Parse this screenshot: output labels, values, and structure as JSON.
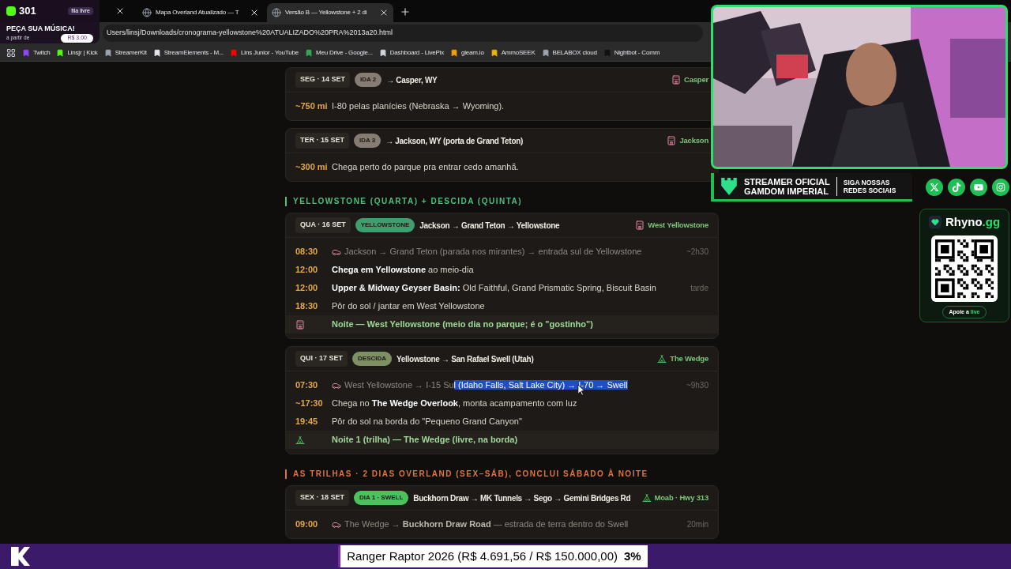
{
  "overlay_widget": {
    "count": "301",
    "chip": "fila livre",
    "title": "PEÇA SUA MÚSICA!",
    "price_label": "a partir de",
    "price": "R$ 3.00"
  },
  "browser": {
    "tabs": [
      {
        "title": "Mapa Overland Atualizado — T",
        "selected": false
      },
      {
        "title": "Versão B — Yellowstone + 2 di",
        "selected": true
      }
    ],
    "address": "Users/linsj/Downloads/cronograma-yellowstone%20ATUALIZADO%20PRA%2013a20.html",
    "bookmarks": [
      {
        "label": "Twitch",
        "color": "#9146ff"
      },
      {
        "label": "Linsjr | Kick",
        "color": "#53fc18"
      },
      {
        "label": "StreamerKit",
        "color": "#9ca3af"
      },
      {
        "label": "StreamElements - M...",
        "color": "#e5e7eb"
      },
      {
        "label": "Lins Junior - YouTube",
        "color": "#ff0000"
      },
      {
        "label": "Meu Drive - Google...",
        "color": "#34a853"
      },
      {
        "label": "Dashboard - LivePix",
        "color": "#d1d5db"
      },
      {
        "label": "gleam.io",
        "color": "#f59e0b"
      },
      {
        "label": "AmmoSEEK",
        "color": "#eab308"
      },
      {
        "label": "BELABOX cloud",
        "color": "#9ca3af"
      },
      {
        "label": "Nightbot - Comm",
        "color": "#111111"
      }
    ]
  },
  "schedule": [
    {
      "kind": "day",
      "date": "SEG · 14 SET",
      "badge": {
        "text": "IDA 2",
        "color": "#857d74"
      },
      "title": "→ Casper, WY",
      "lodging": {
        "kind": "hotel",
        "text": "Casper"
      },
      "rows": [
        {
          "kind": "plain",
          "time": "~750 mi",
          "text": "I-80 pelas planícies (Nebraska → Wyoming)."
        }
      ]
    },
    {
      "kind": "day",
      "date": "TER · 15 SET",
      "badge": {
        "text": "IDA 3",
        "color": "#857d74"
      },
      "title": "→ Jackson, WY (porta de Grand Teton)",
      "lodging": {
        "kind": "hotel",
        "text": "Jackson"
      },
      "rows": [
        {
          "kind": "plain",
          "time": "~300 mi",
          "text": "Chega perto do parque pra entrar cedo amanhã."
        }
      ]
    },
    {
      "kind": "section",
      "text": "YELLOWSTONE (QUARTA) + DESCIDA (QUINTA)",
      "color": "#4fbf7f"
    },
    {
      "kind": "day",
      "date": "QUA · 16 SET",
      "badge": {
        "text": "YELLOWSTONE",
        "color": "#3f9e6e"
      },
      "title": "Jackson → Grand Teton → Yellowstone",
      "lodging": {
        "kind": "hotel",
        "text": "West Yellowstone"
      },
      "rows": [
        {
          "kind": "drive",
          "time": "08:30",
          "text": "Jackson → Grand Teton (parada nos mirantes) → entrada sul de Yellowstone",
          "note": "~2h30"
        },
        {
          "kind": "plain",
          "time": "12:00",
          "text": "**Chega em Yellowstone** ao meio-dia"
        },
        {
          "kind": "plain",
          "time": "12:00",
          "text": "**Upper & Midway Geyser Basin:** Old Faithful, Grand Prismatic Spring, Biscuit Basin",
          "note": "tarde"
        },
        {
          "kind": "plain",
          "time": "18:30",
          "text": "Pôr do sol / jantar em West Yellowstone"
        },
        {
          "kind": "hotel_night",
          "text": "Noite — West Yellowstone (meio dia no parque; é o \"gostinho\")"
        }
      ]
    },
    {
      "kind": "day",
      "date": "QUI · 17 SET",
      "badge": {
        "text": "DESCIDA",
        "color": "#7d8f63"
      },
      "title": "Yellowstone → San Rafael Swell (Utah)",
      "lodging": {
        "kind": "camp",
        "text": "The Wedge"
      },
      "rows": [
        {
          "kind": "drive",
          "time": "07:30",
          "text": "West Yellowstone → I-15 Su",
          "highlight": "l (Idaho Falls, Salt Lake City) → I-70 → Swell",
          "note": "~9h30"
        },
        {
          "kind": "plain",
          "time": "~17:30",
          "text": "Chega no **The Wedge Overlook**, monta acampamento com luz"
        },
        {
          "kind": "plain",
          "time": "19:45",
          "text": "Pôr do sol na borda do \"Pequeno Grand Canyon\""
        },
        {
          "kind": "camp_night",
          "text": "Noite 1 (trilha) — The Wedge (livre, na borda)"
        }
      ]
    },
    {
      "kind": "section",
      "text": "AS TRILHAS · 2 DIAS OVERLAND (SEX–SÁB), CONCLUI SÁBADO À NOITE",
      "color": "#e0733a"
    },
    {
      "kind": "day",
      "date": "SEX · 18 SET",
      "badge": {
        "text": "DIA 1 · SWELL",
        "color": "#4cc25f"
      },
      "title": "Buckhorn Draw → MK Tunnels → Sego → Gemini Bridges Rd",
      "lodging": {
        "kind": "camp",
        "text": "Moab · Hwy 313"
      },
      "rows": [
        {
          "kind": "drive",
          "time": "09:00",
          "text": "The Wedge → **Buckhorn Draw Road** — estrada de terra dentro do Swell",
          "note": "20min"
        }
      ]
    }
  ],
  "sponsor_banner": {
    "line_1": "STREAMER OFICIAL",
    "line_2": "GAMDOM IMPERIAL",
    "social_1": "SIGA NOSSAS",
    "social_2": "REDES SOCIAIS"
  },
  "support_card": {
    "brand": "Rhyno",
    "brand_suffix": ".gg",
    "button": "Apoie a",
    "button_accent": "live"
  },
  "goal_bar": {
    "text": "Ranger Raptor 2026 (R$ 4.691,56 / R$ 150.000,00)",
    "percent": "3%"
  }
}
